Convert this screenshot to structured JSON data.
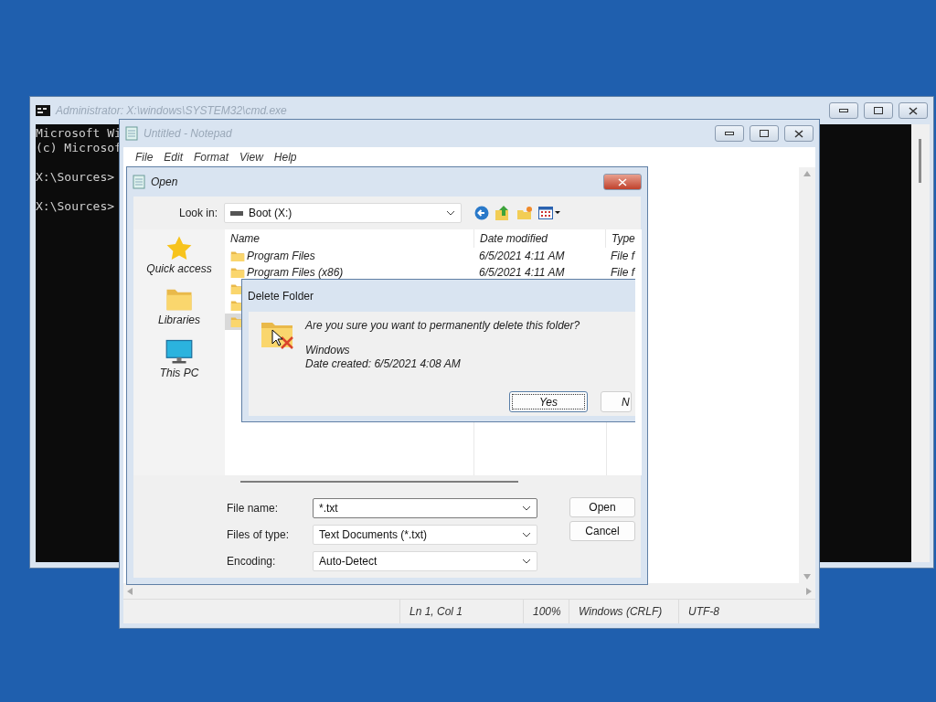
{
  "cmd": {
    "title": "Administrator: X:\\windows\\SYSTEM32\\cmd.exe",
    "blocks": [
      [
        "Microsoft Wi",
        "(c) Microsof"
      ],
      [
        "X:\\Sources>"
      ],
      [
        "X:\\Sources>"
      ]
    ]
  },
  "notepad": {
    "title": "Untitled - Notepad",
    "menu": [
      "File",
      "Edit",
      "Format",
      "View",
      "Help"
    ],
    "status": [
      "Ln 1, Col 1",
      "100%",
      "Windows (CRLF)",
      "UTF-8"
    ]
  },
  "open_dialog": {
    "title": "Open",
    "look_in_label": "Look in:",
    "look_in": "Boot (X:)",
    "places": [
      {
        "label": "Quick access",
        "kind": "star"
      },
      {
        "label": "Libraries",
        "kind": "folder"
      },
      {
        "label": "This PC",
        "kind": "pc"
      }
    ],
    "columns": [
      "Name",
      "Date modified",
      "Type"
    ],
    "rows": [
      {
        "name": "Program Files",
        "date": "6/5/2021 4:11 AM",
        "type": "File f",
        "selected": false
      },
      {
        "name": "Program Files (x86)",
        "date": "6/5/2021 4:11 AM",
        "type": "File f",
        "selected": false
      },
      {
        "selected": false
      },
      {
        "selected": false
      },
      {
        "selected": true
      }
    ],
    "fields": [
      {
        "label": "File name:",
        "value": "*.txt",
        "kind": "edit"
      },
      {
        "label": "Files of type:",
        "value": "Text Documents (*.txt)",
        "kind": "list"
      },
      {
        "label": "Encoding:",
        "value": "Auto-Detect",
        "kind": "list"
      }
    ],
    "buttons": [
      "Open",
      "Cancel"
    ]
  },
  "delete_dialog": {
    "title": "Delete Folder",
    "question": "Are you sure you want to permanently delete this folder?",
    "item_name": "Windows",
    "item_date": "Date created: 6/5/2021 4:08 AM",
    "buttons": [
      {
        "label": "Yes",
        "focused": true
      },
      {
        "label": "N",
        "focused": false
      }
    ]
  }
}
